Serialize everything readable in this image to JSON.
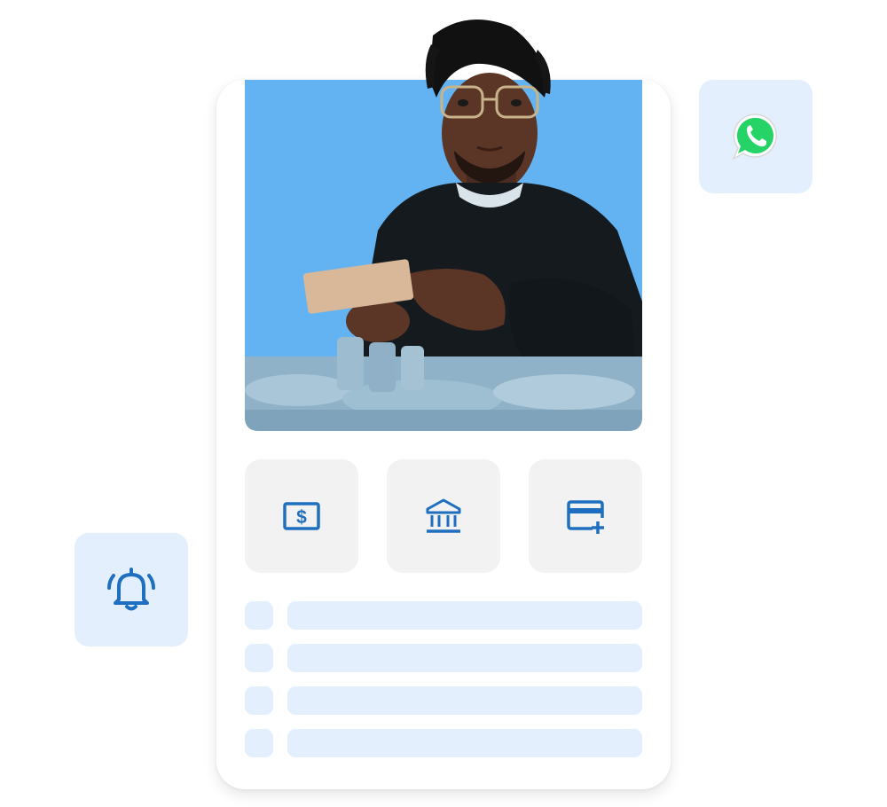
{
  "colors": {
    "photo_background": "#63b3f2",
    "accent_icon": "#1f6fc0",
    "tile_light_blue": "#e3effd",
    "action_tile_grey": "#f2f2f2",
    "whatsapp_green": "#25d366"
  },
  "photo": {
    "subject": "person-holding-banknotes"
  },
  "actions": [
    {
      "icon": "dollar-bill-icon"
    },
    {
      "icon": "bank-icon"
    },
    {
      "icon": "add-card-icon"
    }
  ],
  "list_placeholders": 4,
  "floating": {
    "messaging": {
      "icon": "whatsapp-icon"
    },
    "notifications": {
      "icon": "bell-ringing-icon"
    }
  }
}
